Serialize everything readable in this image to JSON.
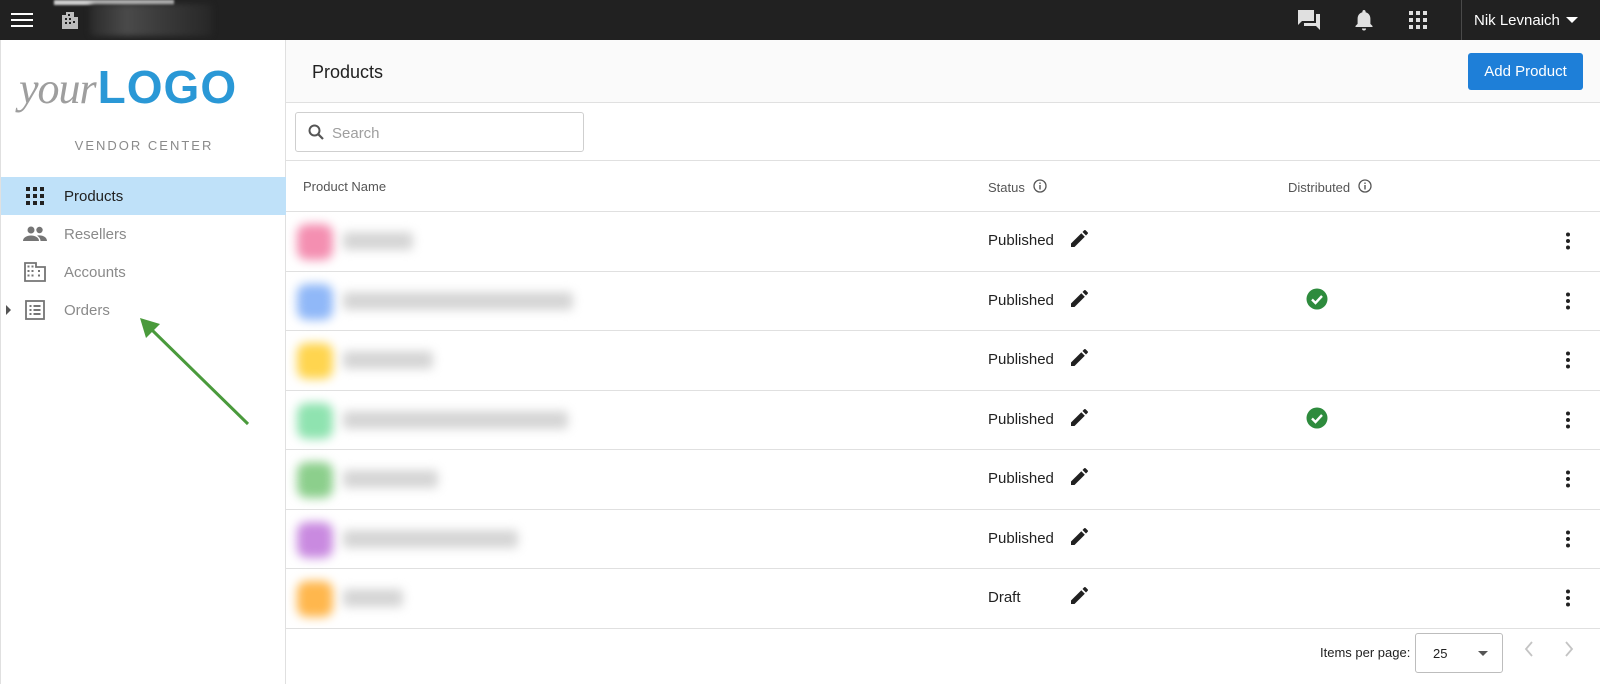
{
  "topbar": {
    "user_name": "Nik Levnaich"
  },
  "sidebar": {
    "logo_your": "your",
    "logo_word": "LOGO",
    "subtitle": "VENDOR CENTER",
    "items": [
      {
        "label": "Products",
        "icon": "grid-icon",
        "active": true
      },
      {
        "label": "Resellers",
        "icon": "people-icon",
        "active": false
      },
      {
        "label": "Accounts",
        "icon": "building-icon",
        "active": false
      },
      {
        "label": "Orders",
        "icon": "list-icon",
        "active": false,
        "expandable": true
      }
    ]
  },
  "header": {
    "title": "Products",
    "add_button": "Add Product"
  },
  "search": {
    "placeholder": "Search",
    "value": ""
  },
  "table": {
    "columns": {
      "name": "Product Name",
      "status": "Status",
      "distributed": "Distributed"
    },
    "rows": [
      {
        "status": "Published",
        "distributed": false,
        "thumb_color": "#f48fb1"
      },
      {
        "status": "Published",
        "distributed": true,
        "thumb_color": "#90b8f8"
      },
      {
        "status": "Published",
        "distributed": false,
        "thumb_color": "#ffd54f"
      },
      {
        "status": "Published",
        "distributed": true,
        "thumb_color": "#8fe3b0"
      },
      {
        "status": "Published",
        "distributed": false,
        "thumb_color": "#8ccf8c"
      },
      {
        "status": "Published",
        "distributed": false,
        "thumb_color": "#c98ae0"
      },
      {
        "status": "Draft",
        "distributed": false,
        "thumb_color": "#ffb74d"
      }
    ]
  },
  "pagination": {
    "items_per_page_label": "Items per page:",
    "items_per_page": "25"
  },
  "colors": {
    "topbar": "#212121",
    "accent": "#1e7fd8",
    "active_nav": "#bfe1f9",
    "logo_blue": "#2a98d6",
    "check_green": "#2e8b3d",
    "arrow_green": "#4a9a3c"
  }
}
